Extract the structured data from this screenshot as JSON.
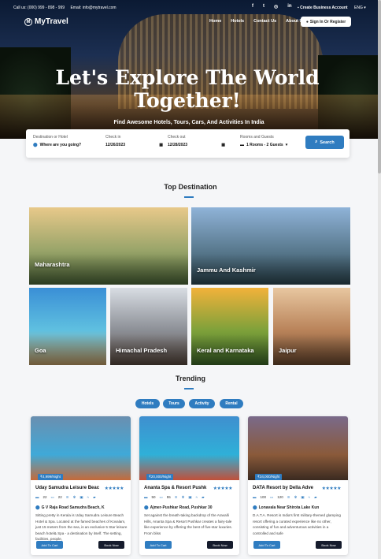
{
  "topbar": {
    "phone": "Call us: (000) 999 - 898 - 999",
    "email": "Email: info@mytravel.com",
    "social_icons": [
      "facebook-icon",
      "twitter-icon",
      "instagram-icon",
      "linkedin-icon"
    ],
    "social_glyphs": [
      "f",
      "t",
      "◎",
      "in"
    ],
    "business": "Create Business Account",
    "language": "ENG"
  },
  "nav": {
    "logo": "MyTravel",
    "logo_mark": "M",
    "menu": [
      "Home",
      "Hotels",
      "Contact Us",
      "About Us"
    ],
    "signin": "Sign In Or Register"
  },
  "hero": {
    "title_line1": "Let's Explore The World",
    "title_line2": "Together!",
    "subtitle": "Find Awesome Hotels, Tours, Cars, And Activities In India"
  },
  "search": {
    "destination_label": "Destination or Hotel",
    "destination_placeholder": "Where are you going?",
    "checkin_label": "Check in",
    "checkin_value": "12/26/2023",
    "checkout_label": "Check out",
    "checkout_value": "12/28/2023",
    "rooms_label": "Rooms and Guests",
    "rooms_value": "1 Rooms - 2 Guests",
    "button": "Search"
  },
  "top_destination": {
    "title": "Top Destination",
    "items": [
      {
        "name": "Maharashtra",
        "colors": [
          "#e8c98a",
          "#9aa56a",
          "#4f6a3a"
        ]
      },
      {
        "name": "Jammu And Kashmir",
        "colors": [
          "#8fb3d8",
          "#5a7a8f",
          "#2f4a55"
        ]
      },
      {
        "name": "Goa",
        "colors": [
          "#3a8fd6",
          "#5fc0e0",
          "#c9a36a"
        ]
      },
      {
        "name": "Himachal Pradesh",
        "colors": [
          "#d8dde3",
          "#8c8f96",
          "#5a4a40"
        ]
      },
      {
        "name": "Keral and Karnataka",
        "colors": [
          "#f2b23a",
          "#7ea13a",
          "#3f6b2a"
        ]
      },
      {
        "name": "Jaipur",
        "colors": [
          "#e8c7a0",
          "#b9835a",
          "#6d4a30"
        ]
      }
    ]
  },
  "trending": {
    "title": "Trending",
    "tabs": [
      "Hotels",
      "Tours",
      "Activity",
      "Rental"
    ],
    "hotels": [
      {
        "price": "₹4,999/Night",
        "name": "Uday Samudra Leisure Beac",
        "stars": "★★★★★",
        "amenities": [
          "22",
          "22"
        ],
        "address": "G V Raja Road Samudra Beach, K",
        "description": "Sitting pretty in Kerala is Uday Samudra Leisure Beach Hotel & Spa. Located at the famed beaches of Kovalam, just 15 meters from the sea, is an exclusive 5 Star leisure beach hotel& Spa - a destination by itself. The setting, facilities, people,",
        "add": "Add To Cart",
        "book": "Book Now",
        "colors": [
          "#6a8fb0",
          "#3fa9d8",
          "#c46a3a"
        ]
      },
      {
        "price": "₹20,000/Night",
        "name": "Ananta Spa & Resort Pushk",
        "stars": "★★★★★",
        "amenities": [
          "50",
          "55"
        ],
        "address": "Ajmer-Pushkar Road, Pushkar 30",
        "description": "Set against the breath-taking backdrop of the Aravalli Hills, Ananta Spa & Resort Pushkar creates a fairy-tale like experience by offering the best of five-star luxuries. From bliss",
        "add": "Add To Cart",
        "book": "Book Now",
        "colors": [
          "#3f8fcf",
          "#2fb0d8",
          "#c0503a"
        ]
      },
      {
        "price": "₹34,000/Night",
        "name": "DATA Resort by Della Adve",
        "stars": "★★★★★",
        "amenities": [
          "100",
          "120"
        ],
        "address": "Lonavala Near Shirota Lake Kun",
        "description": "D.A.T.A. Resort is India's first military-themed glamping resort offering a curated experience like no other, consisting of fun and adventurous activities in a controlled and safe",
        "add": "Add To Cart",
        "book": "Book Now",
        "colors": [
          "#7a6a8a",
          "#8a5a3a",
          "#3a2a20"
        ]
      }
    ]
  }
}
